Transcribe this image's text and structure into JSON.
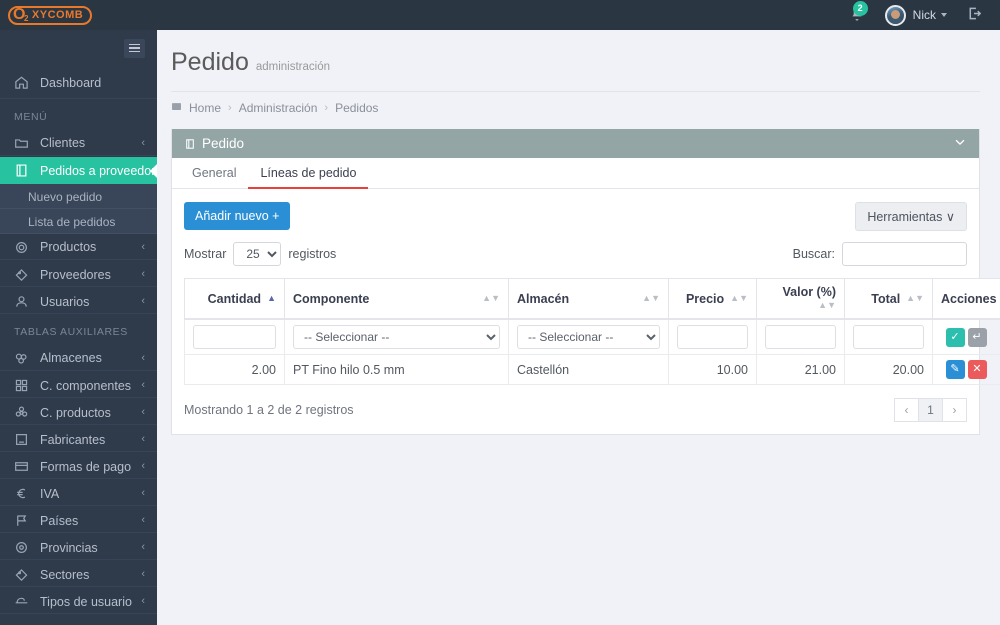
{
  "topbar": {
    "logo_o": "O",
    "logo_sub": "2",
    "logo_word": "XYCOMB",
    "notifications_count": "2",
    "user_name": "Nick",
    "bell_icon": "bell-icon",
    "logout_icon": "logout-icon"
  },
  "sidebar": {
    "dashboard": {
      "label": "Dashboard",
      "icon": "home-icon"
    },
    "heading_menu": "MENÚ",
    "heading_aux": "TABLAS AUXILIARES",
    "items": [
      {
        "label": "Clientes",
        "icon": "folder-icon",
        "chevron": "‹"
      },
      {
        "label": "Pedidos a proveedor",
        "icon": "book-icon",
        "chevron": "∨",
        "active": true
      },
      {
        "label": "Productos",
        "icon": "gear-icon",
        "chevron": "‹"
      },
      {
        "label": "Proveedores",
        "icon": "tag-icon",
        "chevron": "‹"
      },
      {
        "label": "Usuarios",
        "icon": "user-icon",
        "chevron": "‹"
      }
    ],
    "subitems": [
      {
        "label": "Nuevo pedido"
      },
      {
        "label": "Lista de pedidos"
      }
    ],
    "aux_items": [
      {
        "label": "Almacenes",
        "icon": "boxes-icon",
        "chevron": "‹"
      },
      {
        "label": "C. componentes",
        "icon": "grid-icon",
        "chevron": "‹"
      },
      {
        "label": "C. productos",
        "icon": "flower-icon",
        "chevron": "‹"
      },
      {
        "label": "Fabricantes",
        "icon": "building-icon",
        "chevron": "‹"
      },
      {
        "label": "Formas de pago",
        "icon": "card-icon",
        "chevron": "‹"
      },
      {
        "label": "IVA",
        "icon": "euro-icon",
        "chevron": "‹"
      },
      {
        "label": "Países",
        "icon": "flag-icon",
        "chevron": "‹"
      },
      {
        "label": "Provincias",
        "icon": "pin-icon",
        "chevron": "‹"
      },
      {
        "label": "Sectores",
        "icon": "tag-icon",
        "chevron": "‹"
      },
      {
        "label": "Tipos de usuario",
        "icon": "hat-icon",
        "chevron": "‹"
      }
    ]
  },
  "page": {
    "title": "Pedido",
    "subtitle": "administración",
    "breadcrumb": [
      "Home",
      "Administración",
      "Pedidos"
    ],
    "breadcrumb_sep": "›"
  },
  "panel": {
    "title": "Pedido",
    "collapse_icon": "chevron-down-icon",
    "tabs": [
      {
        "label": "General",
        "active": false
      },
      {
        "label": "Líneas de pedido",
        "active": true
      }
    ]
  },
  "toolbar": {
    "add_label": "Añadir nuevo",
    "add_plus": "+",
    "tools_label": "Herramientas",
    "tools_caret": "∨",
    "show_label": "Mostrar",
    "show_value": "25",
    "records_label": "registros",
    "search_label": "Buscar:",
    "search_value": ""
  },
  "table": {
    "columns": [
      {
        "label": "Cantidad",
        "align": "right",
        "sort": "asc"
      },
      {
        "label": "Componente",
        "align": "left",
        "sort": "both"
      },
      {
        "label": "Almacén",
        "align": "left",
        "sort": "both"
      },
      {
        "label": "Precio",
        "align": "right",
        "sort": "both"
      },
      {
        "label": "Valor (%)",
        "align": "right",
        "sort": "both"
      },
      {
        "label": "Total",
        "align": "right",
        "sort": "both"
      },
      {
        "label": "Acciones",
        "align": "center",
        "sort": "none"
      }
    ],
    "filter_row": {
      "cantidad_value": "",
      "componente_value": "-- Seleccionar --",
      "almacen_value": "-- Seleccionar --",
      "precio_value": "",
      "valor_value": "",
      "total_value": "",
      "confirm_icon": "check-icon",
      "undo_icon": "undo-icon"
    },
    "rows": [
      {
        "cantidad": "2.00",
        "componente": "PT Fino hilo 0.5 mm",
        "almacen": "Castellón",
        "precio": "10.00",
        "valor": "21.00",
        "total": "20.00",
        "edit_icon": "pencil-icon",
        "delete_icon": "close-icon"
      }
    ],
    "info": "Mostrando 1 a 2 de 2 registros",
    "pagination": {
      "prev": "‹",
      "pages": [
        "1"
      ],
      "next": "›"
    }
  },
  "colors": {
    "accent_green": "#27c2a0",
    "primary_blue": "#2a8fd4",
    "danger_red": "#eb5b5b",
    "tab_active": "#e8413c",
    "panel_head": "#93a5a5",
    "logo_orange": "#e8792b"
  }
}
